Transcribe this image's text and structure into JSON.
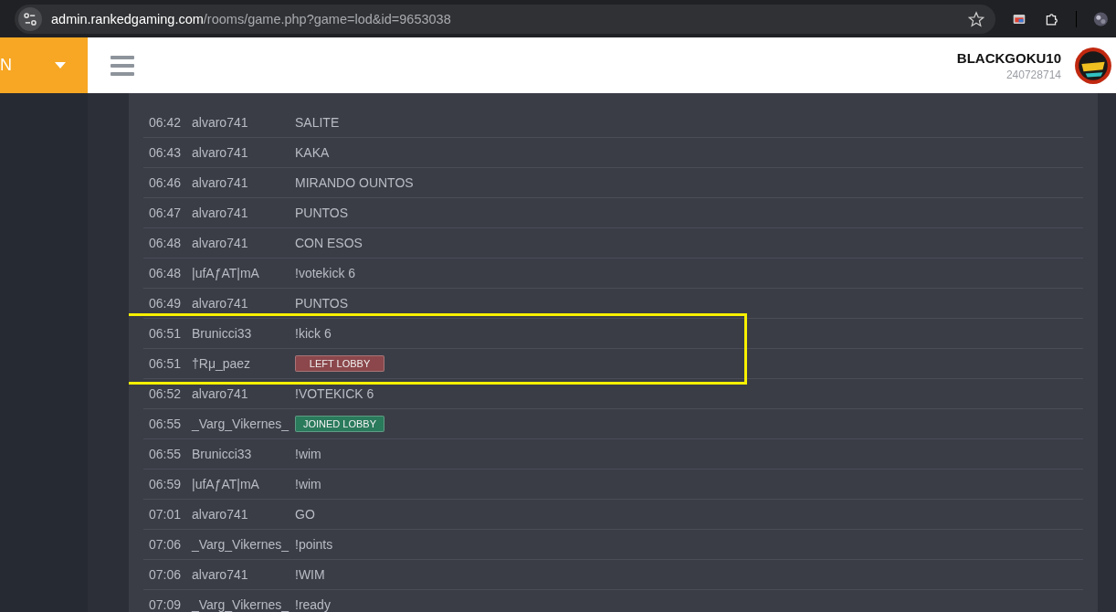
{
  "browser": {
    "url_host": "admin.rankedgaming.com",
    "url_path": "/rooms/game.php?game=lod&id=9653038"
  },
  "header": {
    "brand": "N",
    "username": "BLACKGOKU10",
    "user_id": "240728714"
  },
  "chat": [
    {
      "time": "06:42",
      "user": "alvaro741",
      "kind": "text",
      "message": "SALITE",
      "highlighted": false
    },
    {
      "time": "06:43",
      "user": "alvaro741",
      "kind": "text",
      "message": "KAKA",
      "highlighted": false
    },
    {
      "time": "06:46",
      "user": "alvaro741",
      "kind": "text",
      "message": "MIRANDO OUNTOS",
      "highlighted": false
    },
    {
      "time": "06:47",
      "user": "alvaro741",
      "kind": "text",
      "message": "PUNTOS",
      "highlighted": false
    },
    {
      "time": "06:48",
      "user": "alvaro741",
      "kind": "text",
      "message": "CON ESOS",
      "highlighted": false
    },
    {
      "time": "06:48",
      "user": "|ufAƒAT|mA",
      "kind": "text",
      "message": "!votekick 6",
      "highlighted": false
    },
    {
      "time": "06:49",
      "user": "alvaro741",
      "kind": "text",
      "message": "PUNTOS",
      "highlighted": false
    },
    {
      "time": "06:51",
      "user": "Brunicci33",
      "kind": "text",
      "message": "!kick 6",
      "highlighted": true
    },
    {
      "time": "06:51",
      "user": "†Rμ_paez",
      "kind": "event",
      "message": "LEFT LOBBY",
      "color": "#8b474b",
      "highlighted": true
    },
    {
      "time": "06:52",
      "user": "alvaro741",
      "kind": "text",
      "message": "!VOTEKICK 6",
      "highlighted": false
    },
    {
      "time": "06:55",
      "user": "_Varg_Vikernes_",
      "kind": "event",
      "message": "JOINED LOBBY",
      "color": "#2a7a5c",
      "highlighted": false
    },
    {
      "time": "06:55",
      "user": "Brunicci33",
      "kind": "text",
      "message": "!wim",
      "highlighted": false
    },
    {
      "time": "06:59",
      "user": "|ufAƒAT|mA",
      "kind": "text",
      "message": "!wim",
      "highlighted": false
    },
    {
      "time": "07:01",
      "user": "alvaro741",
      "kind": "text",
      "message": "GO",
      "highlighted": false
    },
    {
      "time": "07:06",
      "user": "_Varg_Vikernes_",
      "kind": "text",
      "message": "!points",
      "highlighted": false
    },
    {
      "time": "07:06",
      "user": "alvaro741",
      "kind": "text",
      "message": "!WIM",
      "highlighted": false
    },
    {
      "time": "07:09",
      "user": "_Varg_Vikernes_",
      "kind": "text",
      "message": "!ready",
      "highlighted": false
    }
  ]
}
